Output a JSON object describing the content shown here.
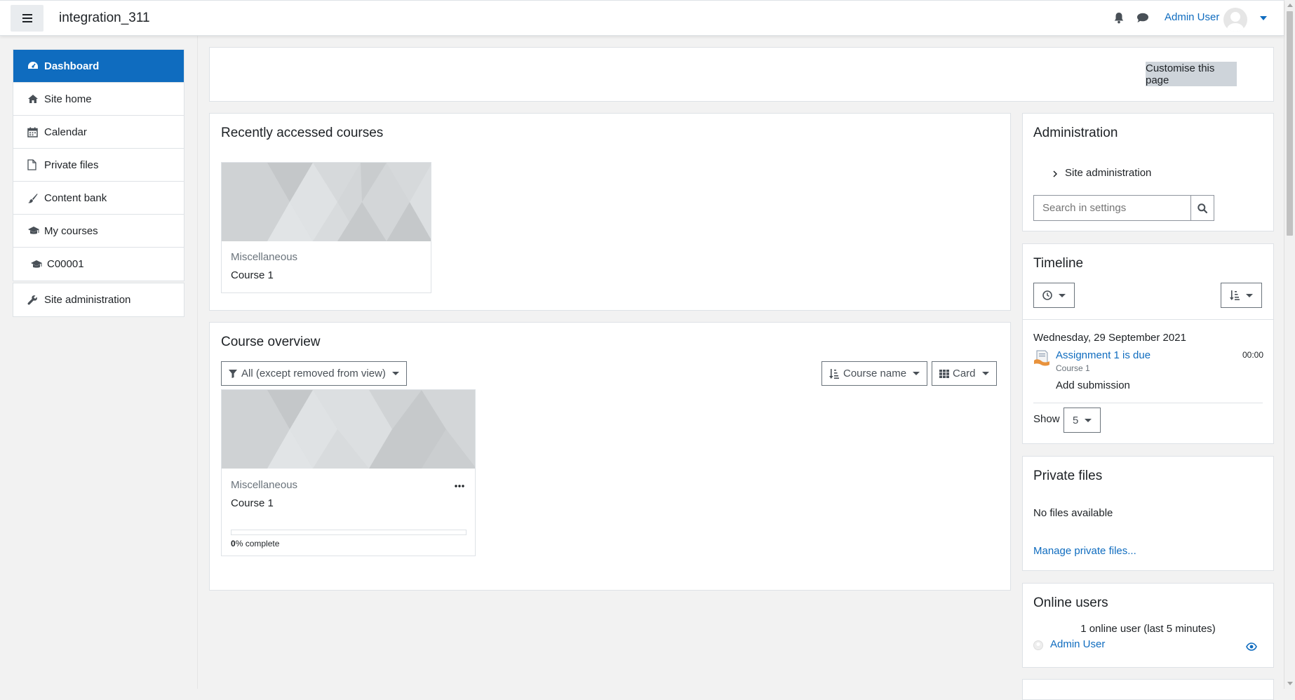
{
  "navbar": {
    "site_name": "integration_311",
    "user_name": "Admin User"
  },
  "drawer": {
    "items": [
      {
        "label": "Dashboard",
        "icon": "dashboard-icon"
      },
      {
        "label": "Site home",
        "icon": "home-icon"
      },
      {
        "label": "Calendar",
        "icon": "calendar-icon"
      },
      {
        "label": "Private files",
        "icon": "file-icon"
      },
      {
        "label": "Content bank",
        "icon": "brush-icon"
      },
      {
        "label": "My courses",
        "icon": "graduation-cap-icon"
      },
      {
        "label": "C00001",
        "icon": "graduation-cap-icon"
      }
    ],
    "site_admin": "Site administration"
  },
  "page_header": {
    "customise_label": "Customise this page"
  },
  "recent": {
    "title": "Recently accessed courses",
    "course": {
      "category": "Miscellaneous",
      "name": "Course 1"
    }
  },
  "overview": {
    "title": "Course overview",
    "filter_label": "All (except removed from view)",
    "sort_label": "Course name",
    "view_label": "Card",
    "course": {
      "category": "Miscellaneous",
      "name": "Course 1",
      "progress_value": "0",
      "progress_suffix": "% complete",
      "progress_fraction": 0
    }
  },
  "administration": {
    "title": "Administration",
    "site_admin_link": "Site administration",
    "search_placeholder": "Search in settings"
  },
  "timeline": {
    "title": "Timeline",
    "date": "Wednesday, 29 September 2021",
    "event_name": "Assignment 1 is due",
    "event_course": "Course 1",
    "event_time": "00:00",
    "event_action": "Add submission",
    "show_label": "Show",
    "show_value": "5"
  },
  "private_files": {
    "title": "Private files",
    "empty_text": "No files available",
    "manage_link": "Manage private files..."
  },
  "online_users": {
    "title": "Online users",
    "summary": "1 online user (last 5 minutes)",
    "user": "Admin User"
  },
  "colors": {
    "primary": "#0f6cbf",
    "background": "#f2f2f2"
  }
}
